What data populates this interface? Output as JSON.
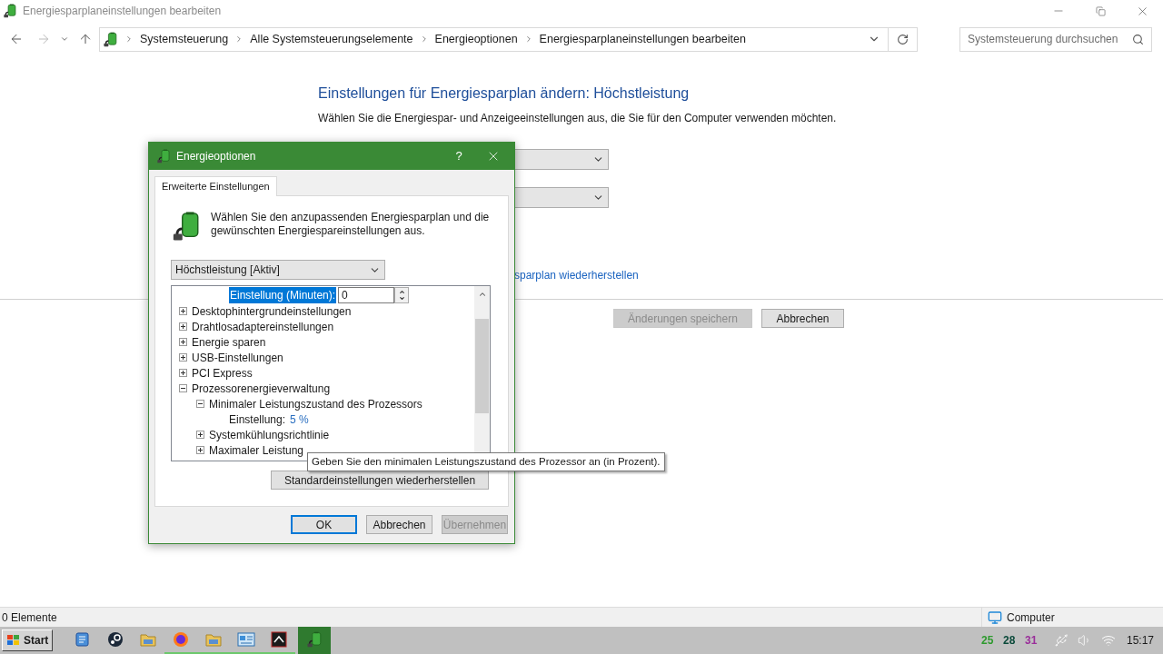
{
  "window": {
    "title": "Energiesparplaneinstellungen bearbeiten"
  },
  "nav": {
    "breadcrumbs": [
      "Systemsteuerung",
      "Alle Systemsteuerungselemente",
      "Energieoptionen",
      "Energiesparplaneinstellungen bearbeiten"
    ],
    "search_placeholder": "Systemsteuerung durchsuchen"
  },
  "page": {
    "heading": "Einstellungen für Energiesparplan ändern: Höchstleistung",
    "subtitle": "Wählen Sie die Energiespar- und Anzeigeeinstellungen aus, die Sie für den Computer verwenden möchten.",
    "link": "sparplan wiederherstellen",
    "buttons": [
      {
        "label": "Änderungen speichern",
        "disabled": true
      },
      {
        "label": "Abbrechen",
        "disabled": false
      }
    ]
  },
  "dialog": {
    "title": "Energieoptionen",
    "help": "?",
    "tab": {
      "label": "Erweiterte Einstellungen",
      "selected": true
    },
    "intro": "Wählen Sie den anzupassenden Energiesparplan und die gewünschten Energiespareinstellungen aus.",
    "plan": "Höchstleistung [Aktiv]",
    "tree": [
      {
        "kind": "spin",
        "label": "Einstellung (Minuten):",
        "value": "0",
        "selected": true
      },
      {
        "kind": "group",
        "label": "Desktophintergrundeinstellungen",
        "expanded": false
      },
      {
        "kind": "group",
        "label": "Drahtlosadaptereinstellungen",
        "expanded": false
      },
      {
        "kind": "group",
        "label": "Energie sparen",
        "expanded": false
      },
      {
        "kind": "group",
        "label": "USB-Einstellungen",
        "expanded": false
      },
      {
        "kind": "group",
        "label": "PCI Express",
        "expanded": false
      },
      {
        "kind": "group",
        "label": "Prozessorenergieverwaltung",
        "expanded": true,
        "children": [
          {
            "kind": "group",
            "label": "Minimaler Leistungszustand des Prozessors",
            "expanded": true,
            "children": [
              {
                "kind": "value",
                "label": "Einstellung:",
                "value": "5 %",
                "selected": false
              }
            ]
          },
          {
            "kind": "group",
            "label": "Systemkühlungsrichtlinie",
            "expanded": false
          },
          {
            "kind": "group",
            "label": "Maximaler Leistung",
            "expanded": false
          }
        ]
      }
    ],
    "tooltip": "Geben Sie den minimalen Leistungszustand des Prozessor an (in Prozent).",
    "restore_button": "Standardeinstellungen wiederherstellen",
    "buttons": [
      {
        "label": "OK",
        "disabled": false,
        "default": true
      },
      {
        "label": "Abbrechen",
        "disabled": false,
        "default": false
      },
      {
        "label": "Übernehmen",
        "disabled": true,
        "default": false
      }
    ]
  },
  "status_bar": {
    "count": "0 Elemente",
    "location": "Computer"
  },
  "taskbar": {
    "start": "Start",
    "apps": [
      {
        "kind": "notepad",
        "running": false,
        "selected": false
      },
      {
        "kind": "steam",
        "running": false,
        "selected": false
      },
      {
        "kind": "folder",
        "running": false,
        "selected": false
      },
      {
        "kind": "browser",
        "running": true,
        "selected": false
      },
      {
        "kind": "folder",
        "running": true,
        "selected": false
      },
      {
        "kind": "panel",
        "running": true,
        "selected": false
      },
      {
        "kind": "terminal",
        "running": true,
        "selected": false
      },
      {
        "kind": "power",
        "running": false,
        "selected": true
      }
    ],
    "tray": [
      {
        "text": "25",
        "color": "#2e9a2e"
      },
      {
        "text": "28",
        "color": "#0b4a3a"
      },
      {
        "text": "31",
        "color": "#9a2e9a"
      }
    ],
    "time": "15:17"
  }
}
